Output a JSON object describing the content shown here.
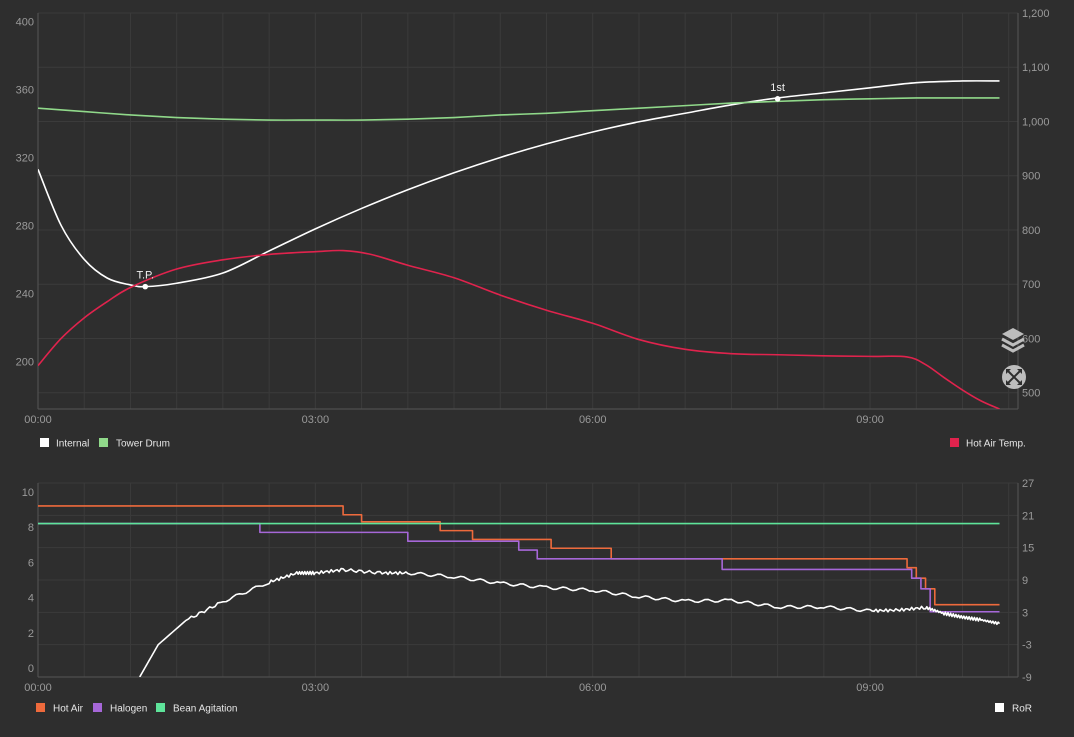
{
  "chart_data": [
    {
      "type": "line",
      "x_unit": "minutes",
      "xticks": [
        "00:00",
        "03:00",
        "06:00",
        "09:00"
      ],
      "xlim": [
        0,
        10.6
      ],
      "left_axis": {
        "ylim": [
          172,
          405
        ],
        "ticks": [
          "200",
          "240",
          "280",
          "320",
          "360",
          "400"
        ]
      },
      "right_axis": {
        "ylim": [
          470,
          1200
        ],
        "ticks": [
          "500",
          "600",
          "700",
          "800",
          "900",
          "1,000",
          "1,100",
          "1,200"
        ]
      },
      "grid": true,
      "series": [
        {
          "name": "Internal",
          "axis": "left",
          "color": "#ffffff",
          "x": [
            0,
            0.25,
            0.5,
            0.75,
            1.0,
            1.16,
            1.5,
            2.0,
            2.5,
            3.0,
            3.5,
            4.0,
            4.5,
            5.0,
            5.5,
            6.0,
            6.5,
            7.0,
            7.5,
            8.0,
            8.5,
            9.0,
            9.5,
            10.0,
            10.4
          ],
          "y": [
            313,
            280,
            260,
            249,
            245,
            244,
            246,
            252,
            265,
            278,
            290,
            301,
            311,
            320,
            328,
            335,
            341,
            346,
            351,
            355,
            358,
            361,
            364,
            365,
            365
          ]
        },
        {
          "name": "Tower Drum",
          "axis": "left",
          "color": "#90d98a",
          "x": [
            0,
            0.5,
            1.0,
            1.5,
            2.0,
            2.5,
            3.0,
            3.5,
            4.0,
            4.5,
            5.0,
            5.5,
            6.0,
            6.5,
            7.0,
            7.5,
            8.0,
            8.5,
            9.0,
            9.5,
            10.0,
            10.4
          ],
          "y": [
            349,
            347,
            345,
            343.5,
            342.5,
            342,
            342,
            342,
            342.5,
            343.5,
            345,
            346,
            347.5,
            349,
            350.5,
            352,
            353,
            354,
            354.5,
            355,
            355,
            355
          ]
        },
        {
          "name": "Hot Air Temp.",
          "axis": "right",
          "color": "#e0234d",
          "x": [
            0,
            0.25,
            0.5,
            0.75,
            1.0,
            1.5,
            2.0,
            2.5,
            3.0,
            3.3,
            3.6,
            4.0,
            4.5,
            5.0,
            5.5,
            6.0,
            6.5,
            7.0,
            7.5,
            8.0,
            8.5,
            9.0,
            9.4,
            9.6,
            9.8,
            10.0,
            10.2,
            10.4
          ],
          "y": [
            550,
            600,
            638,
            668,
            694,
            728,
            745,
            755,
            760,
            762,
            755,
            735,
            712,
            680,
            652,
            628,
            598,
            580,
            572,
            570,
            568,
            567,
            566,
            552,
            528,
            505,
            485,
            470
          ]
        }
      ],
      "annotations": [
        {
          "label": "T.P.",
          "x": 1.16,
          "y": 244,
          "series": "Internal"
        },
        {
          "label": "1st",
          "x": 8.0,
          "y": 354.5,
          "series": "Internal"
        }
      ],
      "legend": {
        "placement": "bottom",
        "left": [
          "Internal",
          "Tower Drum"
        ],
        "right": [
          "Hot Air Temp."
        ]
      }
    },
    {
      "type": "line",
      "x_unit": "minutes",
      "xticks": [
        "00:00",
        "03:00",
        "06:00",
        "09:00"
      ],
      "xlim": [
        0,
        10.6
      ],
      "left_axis": {
        "ylim": [
          -0.5,
          10.5
        ],
        "ticks": [
          "0",
          "2",
          "4",
          "6",
          "8",
          "10"
        ]
      },
      "right_axis": {
        "ylim": [
          -9,
          27
        ],
        "ticks": [
          "-9",
          "-3",
          "3",
          "9",
          "15",
          "21",
          "27"
        ]
      },
      "grid": true,
      "series": [
        {
          "name": "Hot Air",
          "axis": "left",
          "step": true,
          "color": "#ee6a3c",
          "x": [
            0,
            3.3,
            3.5,
            4.35,
            4.7,
            5.55,
            6.2,
            9.4,
            9.5,
            9.6,
            9.7,
            10.4
          ],
          "y": [
            9.2,
            8.7,
            8.3,
            7.8,
            7.3,
            6.8,
            6.2,
            5.7,
            5.1,
            4.5,
            3.6,
            3.6
          ]
        },
        {
          "name": "Halogen",
          "axis": "left",
          "step": true,
          "color": "#a667d8",
          "x": [
            0,
            2.4,
            4.0,
            5.2,
            5.4,
            7.4,
            9.45,
            9.55,
            9.65,
            10.4
          ],
          "y": [
            8.2,
            7.7,
            7.2,
            6.7,
            6.2,
            5.6,
            5.1,
            4.5,
            3.2,
            3.2
          ]
        },
        {
          "name": "Bean Agitation",
          "axis": "left",
          "step": true,
          "color": "#5ee49a",
          "x": [
            0,
            10.4
          ],
          "y": [
            8.2,
            8.2
          ]
        },
        {
          "name": "RoR",
          "axis": "right",
          "color": "#ffffff",
          "x": [
            1.1,
            1.3,
            1.6,
            2.0,
            2.5,
            2.8,
            3.0,
            3.3,
            3.7,
            4.0,
            4.5,
            5.0,
            5.5,
            6.0,
            6.5,
            7.0,
            7.5,
            8.0,
            8.5,
            9.0,
            9.3,
            9.6,
            9.8,
            10.0,
            10.2,
            10.4
          ],
          "y": [
            -9,
            -3,
            1.5,
            5,
            8.6,
            10.3,
            10.3,
            10.9,
            10.3,
            10.3,
            9.6,
            8.4,
            7.6,
            7.1,
            5.9,
            5.1,
            5.2,
            4.0,
            4.0,
            3.3,
            3.4,
            3.9,
            2.8,
            2.1,
            1.6,
            0.9
          ]
        }
      ],
      "legend": {
        "placement": "bottom",
        "left": [
          "Hot Air",
          "Halogen",
          "Bean Agitation"
        ],
        "right": [
          "RoR"
        ]
      }
    }
  ],
  "icons": [
    "layers-icon",
    "zoom-reset-icon"
  ]
}
